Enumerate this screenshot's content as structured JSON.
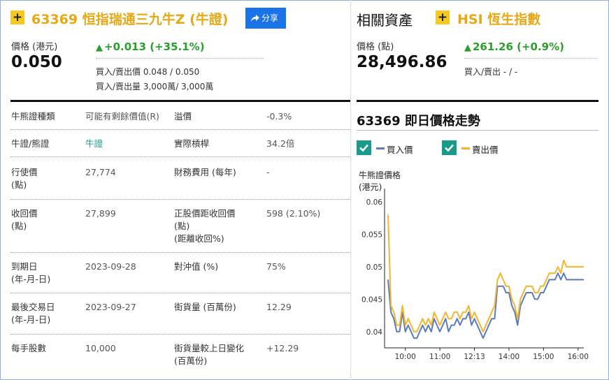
{
  "warrant": {
    "code_name": "63369 恒指瑞通三九牛Z (牛證)",
    "share_label": "分享",
    "price_label": "價格 (港元)",
    "price": "0.050",
    "change": "+0.013 (+35.1%)",
    "bid_ask_price": "買入/賣出價 0.048 / 0.050",
    "bid_ask_volume": "買入/賣出量 3,000萬/ 3,000萬"
  },
  "related": {
    "heading": "相關資產",
    "name": "HSI  恆生指數",
    "price_label": "價格 (點)",
    "price": "28,496.86",
    "change": "261.26 (+0.9%)",
    "bid_ask": "買入/賣出 - / -"
  },
  "details": [
    {
      "l1": "牛熊證種類",
      "v1": "可能有剩餘價值(R)",
      "l2": "溢價",
      "v2": "-0.3%",
      "v1_green": false
    },
    {
      "l1": "牛證/熊證",
      "v1": "牛證",
      "l2": "實際槓桿",
      "v2": "34.2倍",
      "v1_green": true
    },
    {
      "l1": "行使價\n(點)",
      "v1": "27,774",
      "l2": "財務費用 (每年)",
      "v2": "-",
      "v1_green": false
    },
    {
      "l1": "收回價\n(點)",
      "v1": "27,899",
      "l2": "正股價距收回價\n(點)\n(距離收回%)",
      "v2": "598 (2.10%)",
      "v1_green": false
    },
    {
      "l1": "到期日\n(年-月-日)",
      "v1": "2023-09-28",
      "l2": "對沖值 (%)",
      "v2": "75%",
      "v1_green": false
    },
    {
      "l1": "最後交易日\n(年-月-日)",
      "v1": "2023-09-27",
      "l2": "街貨量 (百萬份)",
      "v2": "12.29",
      "v1_green": false
    },
    {
      "l1": "每手股數",
      "v1": "10,000",
      "l2": "街貨量較上日變化\n(百萬份)",
      "v2": "+12.29",
      "v1_green": false
    }
  ],
  "chart_section": {
    "title": "63369 即日價格走勢",
    "legend": [
      {
        "label": "買入價",
        "color": "#5b7bbd",
        "checked": true
      },
      {
        "label": "賣出價",
        "color": "#f5b52b",
        "checked": true
      }
    ]
  },
  "colors": {
    "accent_gold": "#e6a817",
    "up_green": "#2aa02a",
    "teal": "#1a9a8a",
    "share_blue": "#1a73e8"
  },
  "chart_data": {
    "type": "line",
    "ylabel": "牛熊證價格\n(港元)",
    "ylim": [
      0.0375,
      0.0615
    ],
    "yticks": [
      "0.06",
      "0.055",
      "0.05",
      "0.045",
      "0.04"
    ],
    "xticks": [
      "10:00",
      "11:00",
      "12:13",
      "14:00",
      "15:00",
      "16:00"
    ],
    "x": [
      "09:30",
      "09:35",
      "09:40",
      "09:45",
      "09:50",
      "09:55",
      "10:00",
      "10:05",
      "10:10",
      "10:15",
      "10:20",
      "10:25",
      "10:30",
      "10:35",
      "10:40",
      "10:45",
      "10:50",
      "10:55",
      "11:00",
      "11:05",
      "11:10",
      "11:15",
      "11:20",
      "11:25",
      "11:30",
      "11:35",
      "11:40",
      "11:45",
      "11:50",
      "11:55",
      "12:13",
      "13:05",
      "13:10",
      "13:15",
      "13:20",
      "13:25",
      "13:30",
      "13:35",
      "13:40",
      "13:45",
      "13:50",
      "13:55",
      "14:00",
      "14:05",
      "14:10",
      "14:15",
      "14:20",
      "14:25",
      "14:30",
      "14:35",
      "14:40",
      "14:45",
      "14:50",
      "14:55",
      "15:00",
      "15:05",
      "15:10",
      "15:15",
      "15:20",
      "15:25",
      "15:30",
      "15:35",
      "15:40",
      "15:45",
      "15:50",
      "15:55",
      "16:00",
      "16:05",
      "16:10"
    ],
    "series": [
      {
        "name": "買入價",
        "color": "#5b7bbd",
        "values": [
          0.048,
          0.043,
          0.042,
          0.04,
          0.04,
          0.043,
          0.04,
          0.041,
          0.04,
          0.039,
          0.039,
          0.04,
          0.041,
          0.04,
          0.041,
          0.04,
          0.042,
          0.041,
          0.04,
          0.041,
          0.042,
          0.04,
          0.041,
          0.041,
          0.042,
          0.041,
          0.042,
          0.042,
          0.043,
          0.041,
          0.042,
          0.041,
          0.04,
          0.039,
          0.04,
          0.041,
          0.042,
          0.042,
          0.047,
          0.047,
          0.047,
          0.046,
          0.046,
          0.044,
          0.043,
          0.041,
          0.044,
          0.045,
          0.046,
          0.046,
          0.046,
          0.045,
          0.045,
          0.046,
          0.046,
          0.047,
          0.048,
          0.048,
          0.048,
          0.049,
          0.048,
          0.049,
          0.048,
          0.048,
          0.048,
          0.048,
          0.048,
          0.048,
          0.048
        ]
      },
      {
        "name": "賣出價",
        "color": "#f5b52b",
        "values": [
          0.058,
          0.044,
          0.043,
          0.041,
          0.041,
          0.044,
          0.041,
          0.042,
          0.041,
          0.04,
          0.04,
          0.041,
          0.042,
          0.041,
          0.042,
          0.041,
          0.043,
          0.042,
          0.041,
          0.042,
          0.043,
          0.042,
          0.042,
          0.043,
          0.043,
          0.042,
          0.043,
          0.043,
          0.044,
          0.042,
          0.043,
          0.042,
          0.041,
          0.04,
          0.041,
          0.042,
          0.043,
          0.044,
          0.048,
          0.049,
          0.048,
          0.047,
          0.047,
          0.045,
          0.044,
          0.042,
          0.045,
          0.046,
          0.047,
          0.047,
          0.047,
          0.046,
          0.046,
          0.047,
          0.047,
          0.048,
          0.049,
          0.049,
          0.049,
          0.05,
          0.049,
          0.051,
          0.05,
          0.05,
          0.05,
          0.05,
          0.05,
          0.05,
          0.05
        ]
      }
    ]
  }
}
